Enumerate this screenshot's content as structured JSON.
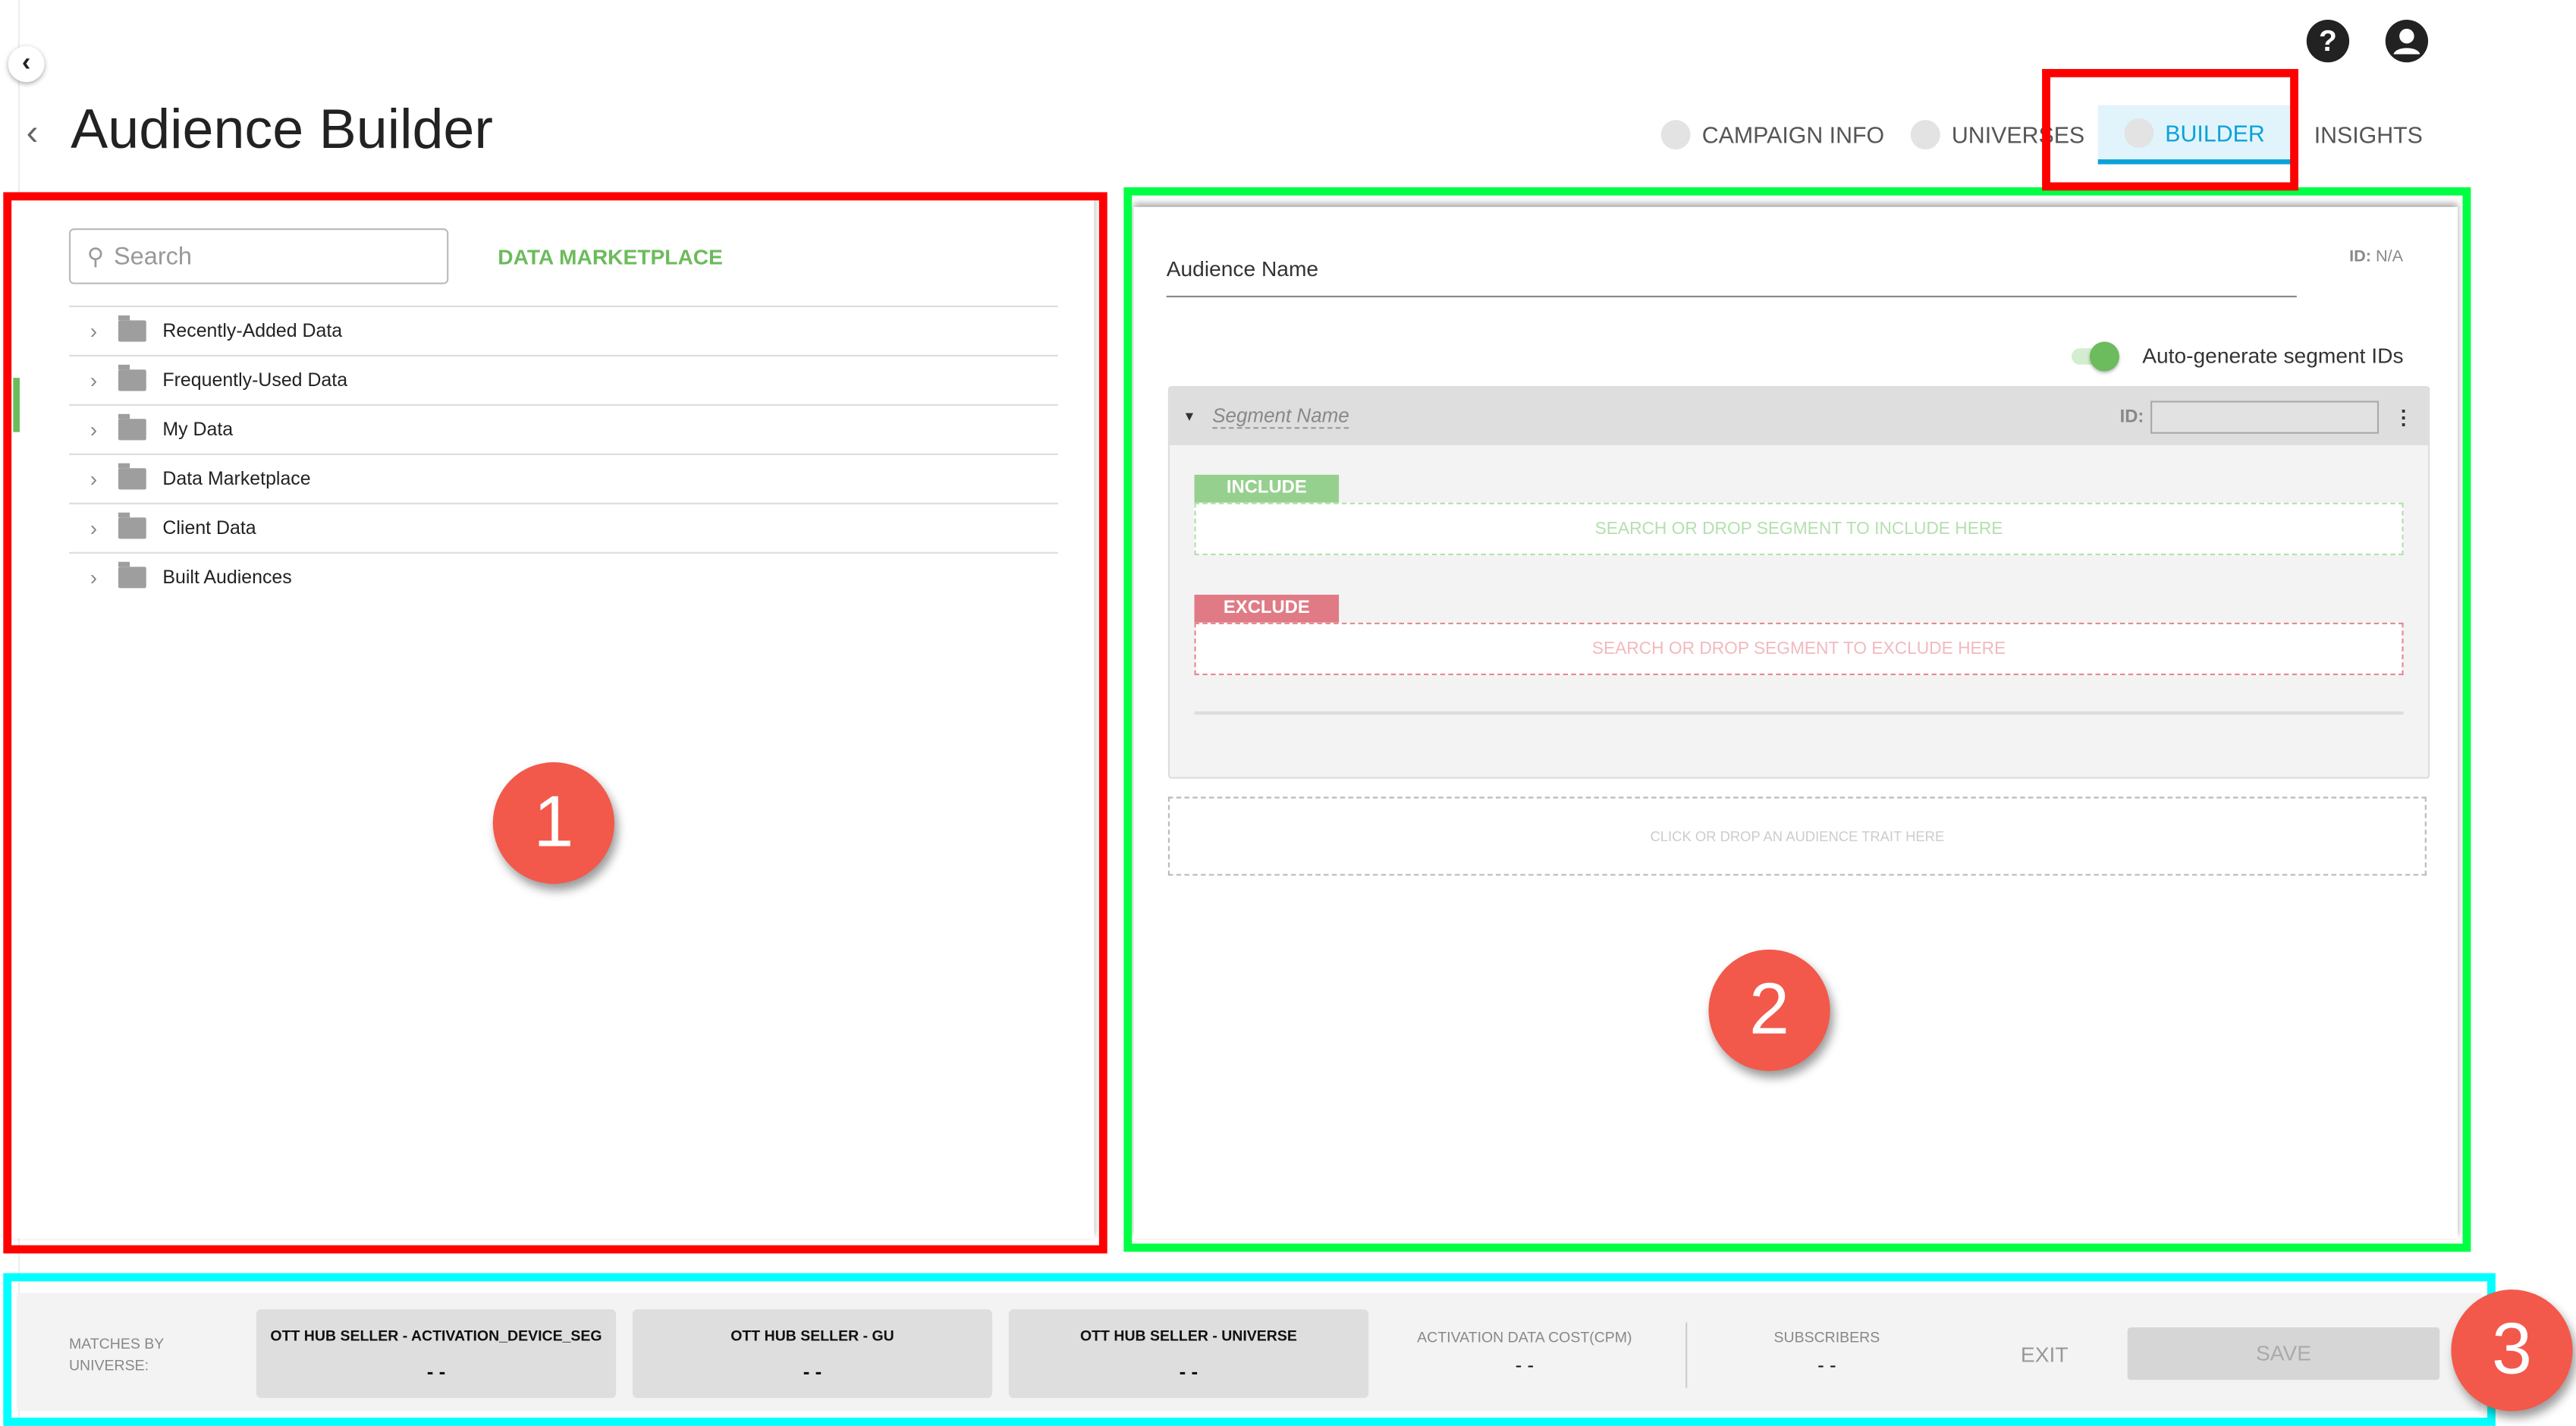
{
  "header": {
    "title": "Audience Builder",
    "back_icon": "chevron-left-icon",
    "help_icon": "?",
    "user_icon": "user-icon",
    "steps": [
      {
        "label": "CAMPAIGN INFO",
        "active": false
      },
      {
        "label": "UNIVERSES",
        "active": false
      },
      {
        "label": "BUILDER",
        "active": true
      },
      {
        "label": "INSIGHTS",
        "active": false
      }
    ]
  },
  "left_panel": {
    "search_placeholder": "Search",
    "marketplace_link": "DATA MARKETPLACE",
    "folders": [
      {
        "label": "Recently-Added Data"
      },
      {
        "label": "Frequently-Used Data"
      },
      {
        "label": "My Data"
      },
      {
        "label": "Data Marketplace"
      },
      {
        "label": "Client Data"
      },
      {
        "label": "Built Audiences"
      }
    ]
  },
  "builder": {
    "audience_name_placeholder": "Audience Name",
    "id_label": "ID:",
    "id_value": "N/A",
    "auto_generate_label": "Auto-generate segment IDs",
    "auto_generate_on": true,
    "segment_name_placeholder": "Segment Name",
    "segment_id_label": "ID:",
    "include_label": "INCLUDE",
    "include_drop": "SEARCH OR DROP SEGMENT TO INCLUDE HERE",
    "exclude_label": "EXCLUDE",
    "exclude_drop": "SEARCH OR DROP SEGMENT TO EXCLUDE HERE",
    "trait_drop": "CLICK OR DROP AN AUDIENCE TRAIT HERE"
  },
  "footer": {
    "matches_label": "MATCHES BY UNIVERSE:",
    "universes": [
      {
        "name": "OTT HUB SELLER - ACTIVATION_DEVICE_SEG",
        "value": "- -"
      },
      {
        "name": "OTT HUB SELLER - GU",
        "value": "- -"
      },
      {
        "name": "OTT HUB SELLER - UNIVERSE",
        "value": "- -"
      }
    ],
    "cost_label": "ACTIVATION DATA COST(CPM)",
    "cost_value": "- -",
    "subscribers_label": "SUBSCRIBERS",
    "subscribers_value": "- -",
    "exit_label": "EXIT",
    "save_label": "SAVE"
  },
  "annotations": {
    "n1": "1",
    "n2": "2",
    "n3": "3",
    "colors": {
      "box1": "#ff0000",
      "box2": "#00ff44",
      "box3": "#00ffff",
      "builder_tab_box": "#ff0000"
    }
  },
  "colors": {
    "accent": "#0aa3d8",
    "green": "#6cbb5c",
    "include": "#96d08f",
    "exclude": "#e07b86"
  }
}
